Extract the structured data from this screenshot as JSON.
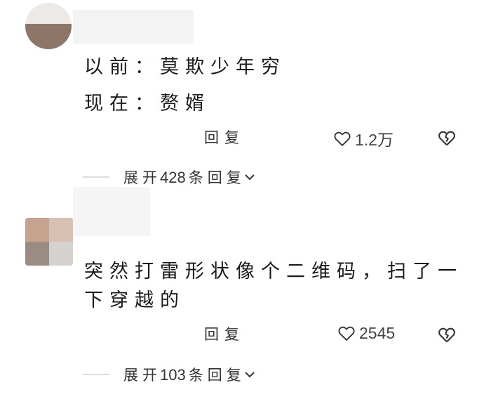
{
  "comments": [
    {
      "lines": [
        "以前：莫欺少年穷",
        "现在：赘婿"
      ],
      "reply_label": "回复",
      "like_count": "1.2万",
      "expand": {
        "prefix": "展开",
        "count": "428",
        "suffix": "条回复"
      }
    },
    {
      "lines": [
        "突然打雷形状像个二维码，扫了一",
        "下穿越的"
      ],
      "reply_label": "回复",
      "like_count": "2545",
      "expand": {
        "prefix": "展开",
        "count": "103",
        "suffix": "条回复"
      }
    }
  ],
  "icons": {
    "like": "heart-outline-icon",
    "dislike": "broken-heart-icon",
    "expand": "chevron-down-icon"
  }
}
